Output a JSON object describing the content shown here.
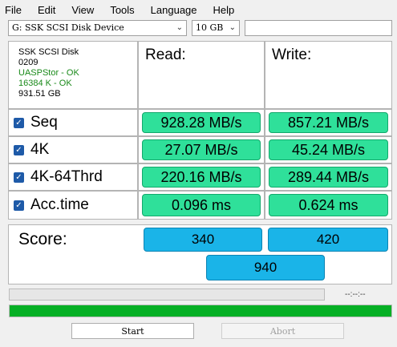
{
  "menu": [
    "File",
    "Edit",
    "View",
    "Tools",
    "Language",
    "Help"
  ],
  "drive": {
    "selected": "G: SSK  SCSI Disk Device"
  },
  "size": {
    "selected": "10 GB"
  },
  "info": {
    "name": "SSK  SCSI Disk",
    "version": "0209",
    "driver": "UASPStor - OK",
    "align": "16384 K - OK",
    "capacity": "931.51 GB"
  },
  "headers": {
    "read": "Read:",
    "write": "Write:"
  },
  "rows": [
    {
      "label": "Seq",
      "read": "928.28 MB/s",
      "write": "857.21 MB/s"
    },
    {
      "label": "4K",
      "read": "27.07 MB/s",
      "write": "45.24 MB/s"
    },
    {
      "label": "4K-64Thrd",
      "read": "220.16 MB/s",
      "write": "289.44 MB/s"
    },
    {
      "label": "Acc.time",
      "read": "0.096 ms",
      "write": "0.624 ms"
    }
  ],
  "score": {
    "label": "Score:",
    "read": "340",
    "write": "420",
    "total": "940"
  },
  "time_display": "--:--:--",
  "progress_fraction": 1.0,
  "buttons": {
    "start": "Start",
    "abort": "Abort"
  },
  "colors": {
    "result_fill": "#2fe09a",
    "score_fill": "#1ab4e8",
    "progress": "#06b025",
    "ok_text": "#1a8a1a"
  }
}
